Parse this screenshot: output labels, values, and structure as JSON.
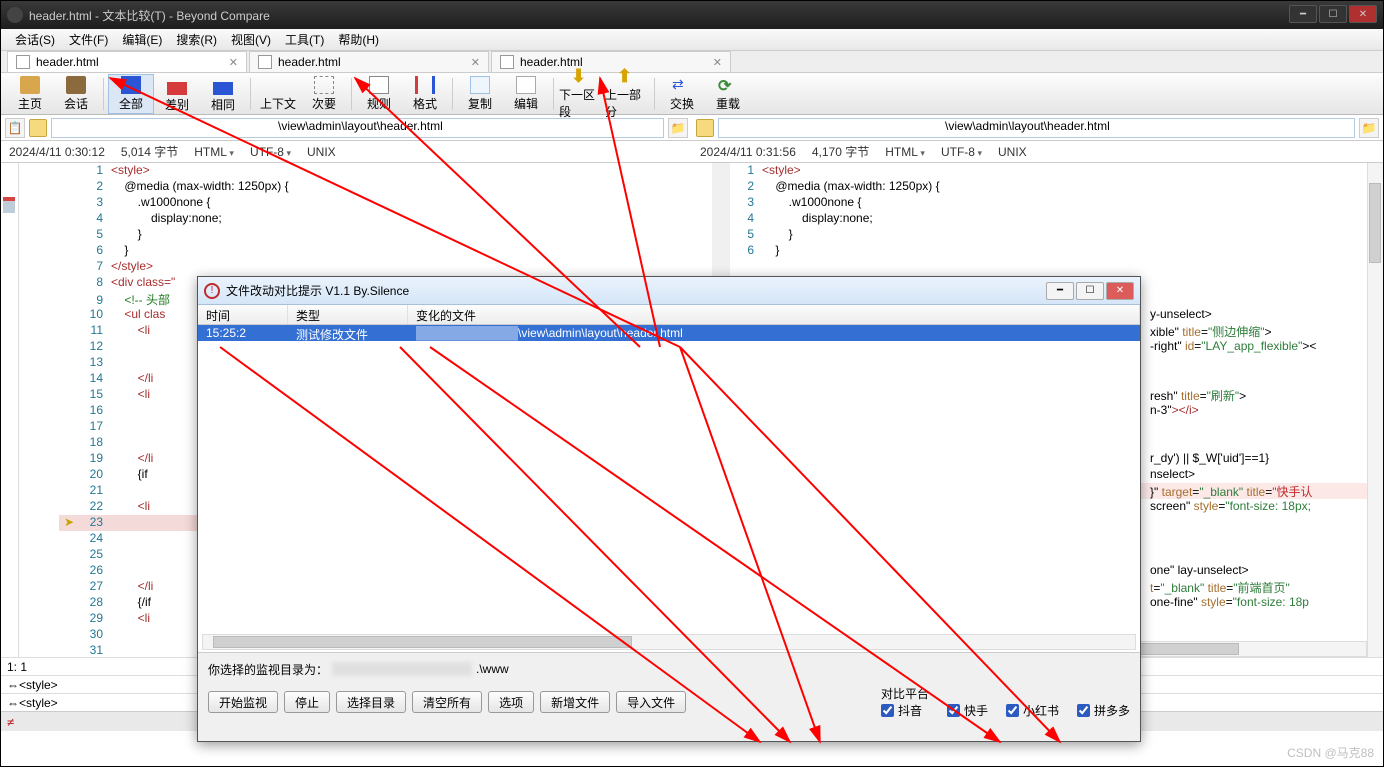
{
  "window": {
    "title": "header.html - 文本比较(T) - Beyond Compare"
  },
  "menu": {
    "session": "会话(S)",
    "file": "文件(F)",
    "edit": "编辑(E)",
    "search": "搜索(R)",
    "view": "视图(V)",
    "tools": "工具(T)",
    "help": "帮助(H)"
  },
  "tabs": {
    "t1": "header.html",
    "t2": "header.html",
    "t3": "header.html"
  },
  "toolbar": {
    "home": "主页",
    "session": "会话",
    "all": "全部",
    "diff": "差别",
    "same": "相同",
    "context": "上下文",
    "minor": "次要",
    "rules": "规则",
    "format": "格式",
    "copy": "复制",
    "edit2": "编辑",
    "next": "下一区段",
    "prev": "上一部分",
    "swap": "交换",
    "reload": "重载"
  },
  "paths": {
    "left": "\\view\\admin\\layout\\header.html",
    "right": "\\view\\admin\\layout\\header.html"
  },
  "info": {
    "left_time": "2024/4/11 0:30:12",
    "left_size": "5,014 字节",
    "right_time": "2024/4/11 0:31:56",
    "right_size": "4,170 字节",
    "lang": "HTML",
    "enc": "UTF-8",
    "eol": "UNIX"
  },
  "code_left": {
    "l1": "<style>",
    "l2": "    @media (max-width: 1250px) {",
    "l3": "        .w1000none {",
    "l4": "            display:none;",
    "l5": "        }",
    "l6": "    }",
    "l7": "</style>",
    "l8": "<div class=\"",
    "l9": "    <!-- 头部",
    "l10": "    <ul clas",
    "l11": "        <li",
    "l12": "",
    "l13": "",
    "l14": "        </li",
    "l15": "        <li",
    "l16": "",
    "l17": "",
    "l18": "",
    "l19": "        </li",
    "l20": "        {if",
    "l21": "",
    "l22": "        <li",
    "l23n": "23",
    "l23": "",
    "l24": "",
    "l25": "",
    "l26": "",
    "l27": "        </li",
    "l28": "        {/if",
    "l29": "        <li",
    "l30": "",
    "l31": ""
  },
  "code_right": {
    "l1": "<style>",
    "l2": "    @media (max-width: 1250px) {",
    "l3": "        .w1000none {",
    "l4": "            display:none;",
    "l5": "        }",
    "l6": "    }",
    "r_a1": "y-unselect>",
    "r_a2_a": "xible\" ",
    "r_a2_b": "title",
    "r_a2_c": "=",
    "r_a2_d": "\"侧边伸缩\"",
    "r_a2_e": ">",
    "r_a3_a": "-right\" ",
    "r_a3_b": "id",
    "r_a3_c": "=",
    "r_a3_d": "\"LAY_app_flexible\"",
    "r_a3_e": "><",
    "r_a4_a": "resh\" ",
    "r_a4_b": "title",
    "r_a4_c": "=",
    "r_a4_d": "\"刷新\"",
    "r_a4_e": ">",
    "r_a5_a": "n-3\"",
    "r_a5_b": "></i>",
    "r_a6_a": "r_dy') || $_W['uid']==1}",
    "r_a7_a": "nselect>",
    "r_a8_a": "}\" ",
    "r_a8_b": "target",
    "r_a8_c": "=",
    "r_a8_d": "\"_blank\" ",
    "r_a8_e": "title",
    "r_a8_f": "=",
    "r_a8_g": "\"快手认",
    "r_a9_a": "screen\" ",
    "r_a9_b": "style",
    "r_a9_c": "=",
    "r_a9_d": "\"font-size: 18px;",
    "r_b1_a": "one\" ",
    "r_b1_b": "lay-unselect>",
    "r_b2_a": "t",
    "r_b2_b": "=",
    "r_b2_c": "\"_blank\" ",
    "r_b2_d": "title",
    "r_b2_e": "=",
    "r_b2_f": "\"前端首页\"",
    "r_b3_a": "one-fine\" ",
    "r_b3_b": "style",
    "r_b3_c": "=",
    "r_b3_d": "\"font-size: 18p"
  },
  "midstatus": {
    "pos": "1: 1",
    "sel1": "⇔<style>",
    "sel2": "⇔<style>"
  },
  "dialog": {
    "title": "文件改动对比提示 V1.1  By.Silence",
    "col_time": "时间",
    "col_type": "类型",
    "col_file": "变化的文件",
    "row_time": "15:25:2",
    "row_type": "测试修改文件",
    "row_file": "\\view\\admin\\layout\\header.html",
    "dir_label_a": "你选择的监视目录为：",
    "dir_label_b": ".\\www",
    "btn_start": "开始监视",
    "btn_stop": "停止",
    "btn_dir": "选择目录",
    "btn_clear": "清空所有",
    "btn_opt": "选项",
    "btn_new": "新增文件",
    "btn_import": "导入文件",
    "plat_title": "对比平台",
    "plat_dy": "抖音",
    "plat_ks": "快手",
    "plat_xhs": "小红书",
    "plat_pdd": "拼多多"
  },
  "watermark": "CSDN @马克88"
}
